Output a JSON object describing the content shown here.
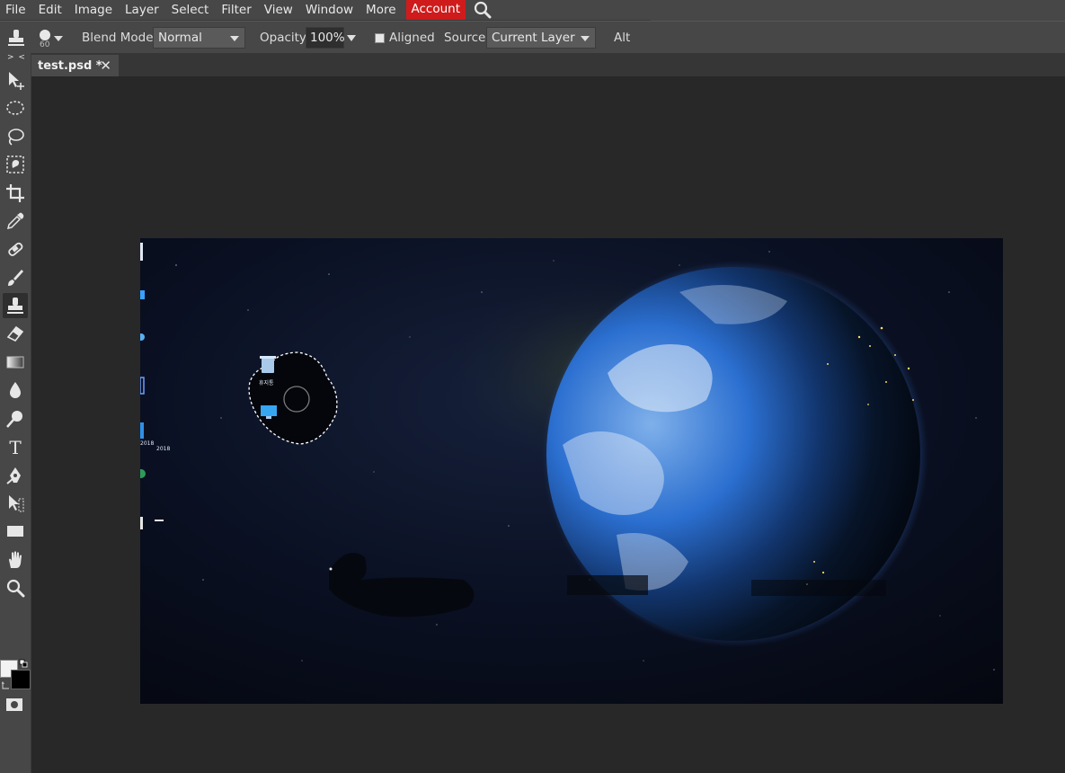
{
  "menu": {
    "items": [
      "File",
      "Edit",
      "Image",
      "Layer",
      "Select",
      "Filter",
      "View",
      "Window",
      "More"
    ],
    "account": "Account"
  },
  "options": {
    "brush_size": "60",
    "blend_mode_label": "Blend Mode:",
    "blend_mode_value": "Normal",
    "opacity_label": "Opacity:",
    "opacity_value": "100%",
    "aligned_label": "Aligned",
    "aligned_checked": false,
    "source_label": "Source:",
    "source_value": "Current Layer",
    "alt_label": "Alt"
  },
  "toolbar": {
    "collapse_label": "> <",
    "tools": [
      "move-tool",
      "marquee-tool",
      "lasso-tool",
      "quick-select-tool",
      "crop-tool",
      "eyedropper-tool",
      "healing-tool",
      "brush-tool",
      "clone-stamp-tool",
      "eraser-tool",
      "gradient-tool",
      "blur-tool",
      "dodge-tool",
      "type-tool",
      "pen-tool",
      "path-select-tool",
      "shape-tool",
      "hand-tool",
      "zoom-tool"
    ],
    "active_tool": "clone-stamp-tool",
    "foreground_color": "#f2f2f2",
    "background_color": "#000000"
  },
  "tabs": [
    {
      "label": "test.psd *",
      "close": "✕"
    }
  ],
  "canvas": {
    "desktop_icon_labels": [
      "휴지통",
      "2018",
      "2018"
    ],
    "theme": {
      "accent": "#cf1b1b",
      "space": "#05070f",
      "earth_blue": "#2b6fd0"
    }
  }
}
